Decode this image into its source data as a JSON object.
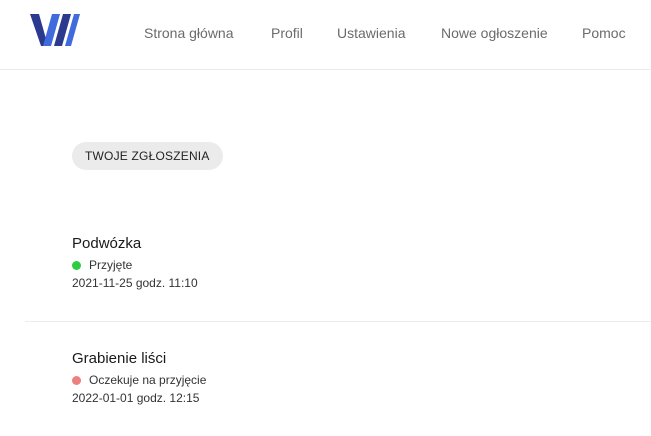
{
  "brand": {
    "logo_letter": "W",
    "colors": {
      "logo_dark": "#2b3a8f",
      "logo_light": "#3f6bdc"
    }
  },
  "nav": {
    "items": [
      {
        "label": "Strona główna"
      },
      {
        "label": "Profil"
      },
      {
        "label": "Ustawienia"
      },
      {
        "label": "Nowe ogłoszenie"
      },
      {
        "label": "Pomoc"
      }
    ]
  },
  "section": {
    "chip_label": "TWOJE ZGŁOSZENIA"
  },
  "requests": [
    {
      "title": "Podwózka",
      "status": "Przyjęte",
      "status_color": "#2ecc40",
      "date": "2021-11-25 godz. 11:10"
    },
    {
      "title": "Grabienie liści",
      "status": "Oczekuje na przyjęcie",
      "status_color": "#ee7f7f",
      "date": "2022-01-01 godz. 12:15"
    }
  ]
}
